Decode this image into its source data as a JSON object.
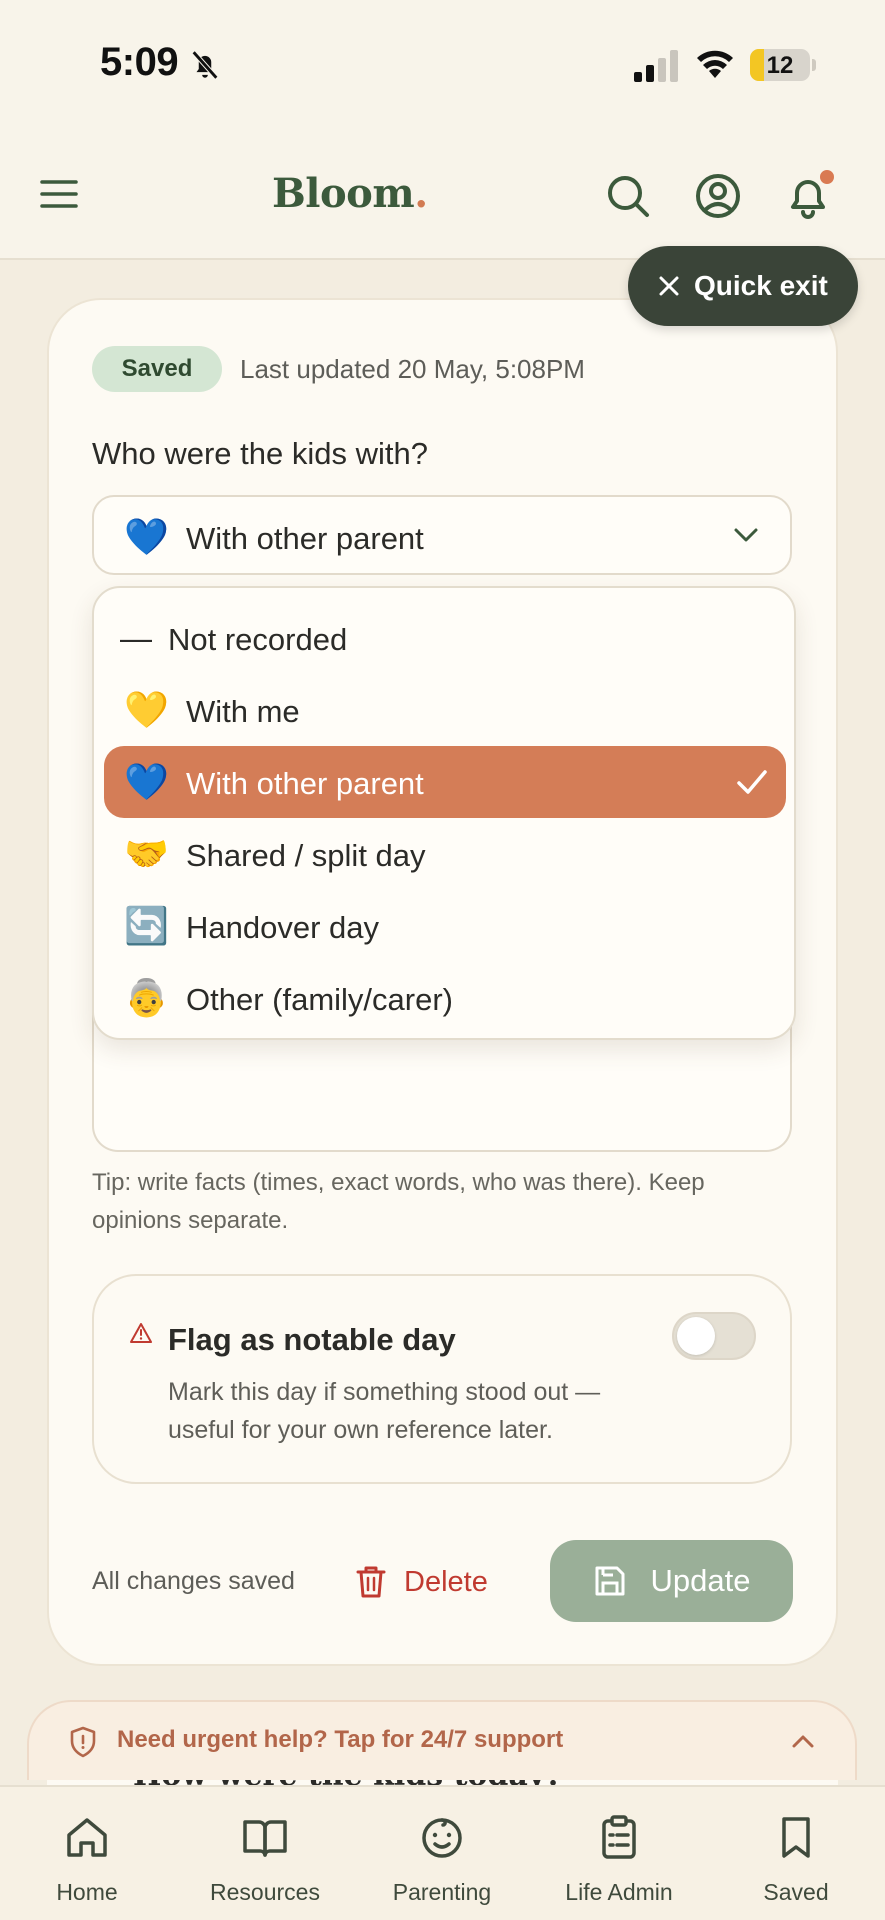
{
  "status_bar": {
    "time": "5:09",
    "battery": "12"
  },
  "header": {
    "logo_text": "Bloom",
    "logo_dot": "."
  },
  "quick_exit": {
    "label": "Quick exit"
  },
  "entry": {
    "status_badge": "Saved",
    "last_updated": "Last updated 20 May, 5:08PM",
    "question": "Who were the kids with?",
    "selected": {
      "emoji": "💙",
      "label": "With other parent"
    },
    "options": [
      {
        "emoji": "—",
        "label": "Not recorded",
        "selected": false
      },
      {
        "emoji": "💛",
        "label": "With me",
        "selected": false
      },
      {
        "emoji": "💙",
        "label": "With other parent",
        "selected": true
      },
      {
        "emoji": "🤝",
        "label": "Shared / split day",
        "selected": false
      },
      {
        "emoji": "🔄",
        "label": "Handover day",
        "selected": false
      },
      {
        "emoji": "👵",
        "label": "Other (family/carer)",
        "selected": false
      }
    ],
    "tip": "Tip: write facts (times, exact words, who was there). Keep opinions separate.",
    "flag": {
      "title": "Flag as notable day",
      "description": "Mark this day if something stood out — useful for your own reference later.",
      "enabled": false
    },
    "all_saved": "All changes saved",
    "delete_label": "Delete",
    "update_label": "Update"
  },
  "urgent_help": {
    "label": "Need urgent help? Tap for 24/7 support"
  },
  "peek_section_title": "How were the kids today?",
  "bottom_nav": [
    {
      "label": "Home",
      "icon": "home-icon"
    },
    {
      "label": "Resources",
      "icon": "book-icon"
    },
    {
      "label": "Parenting",
      "icon": "baby-face-icon"
    },
    {
      "label": "Life Admin",
      "icon": "clipboard-icon"
    },
    {
      "label": "Saved",
      "icon": "bookmark-icon"
    }
  ],
  "colors": {
    "accent": "#d47d57",
    "brand_green": "#3c5a3c",
    "quick_exit_bg": "#3a4438",
    "danger": "#c03a30",
    "update_btn": "#9aaf98"
  }
}
